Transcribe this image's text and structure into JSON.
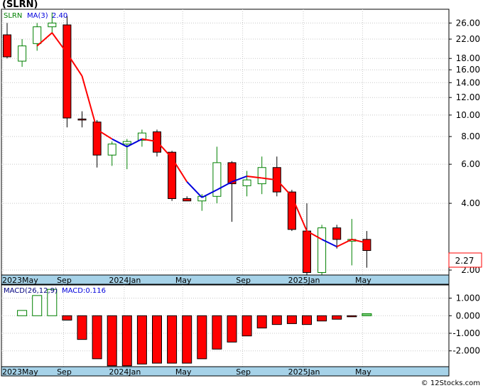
{
  "title": "(SLRN)",
  "watermark": "© 12Stocks.com",
  "colors": {
    "up_candle": "#008000",
    "down_candle": "#ff0000",
    "ma_down": "#ff0000",
    "ma_up": "#0000dd",
    "macd_text": "#000080",
    "axis_band": "#a6d2e8",
    "last_price_box": "#ff0000"
  },
  "chart_data": [
    {
      "type": "candlestick",
      "legend": {
        "ticker": "SLRN",
        "ma_label": "MA(3)",
        "ma_value": "2.40"
      },
      "y_scale": "log",
      "ylim": [
        1.9,
        30
      ],
      "y_ticks": [
        "26.00",
        "22.00",
        "18.00",
        "16.00",
        "14.00",
        "12.00",
        "10.00",
        "8.00",
        "6.00",
        "4.00",
        "2.00"
      ],
      "x_ticks": [
        "2023May",
        "Sep",
        "2024Jan",
        "May",
        "Sep",
        "2025Jan",
        "May"
      ],
      "last_price": "2.27",
      "candles": [
        {
          "o": 23.0,
          "h": 26.0,
          "l": 18.0,
          "c": 18.3
        },
        {
          "o": 17.5,
          "h": 22.0,
          "l": 16.5,
          "c": 20.5
        },
        {
          "o": 21.0,
          "h": 26.0,
          "l": 19.5,
          "c": 25.0
        },
        {
          "o": 25.0,
          "h": 29.0,
          "l": 23.5,
          "c": 26.0
        },
        {
          "o": 25.5,
          "h": 28.0,
          "l": 8.8,
          "c": 9.7
        },
        {
          "o": 9.6,
          "h": 10.4,
          "l": 8.8,
          "c": 9.5
        },
        {
          "o": 9.3,
          "h": 9.5,
          "l": 5.8,
          "c": 6.6
        },
        {
          "o": 6.6,
          "h": 7.6,
          "l": 5.9,
          "c": 7.4
        },
        {
          "o": 7.4,
          "h": 7.8,
          "l": 5.7,
          "c": 7.6
        },
        {
          "o": 7.7,
          "h": 8.6,
          "l": 7.2,
          "c": 8.3
        },
        {
          "o": 8.4,
          "h": 8.6,
          "l": 6.5,
          "c": 6.8
        },
        {
          "o": 6.8,
          "h": 6.9,
          "l": 4.1,
          "c": 4.2
        },
        {
          "o": 4.2,
          "h": 4.3,
          "l": 4.1,
          "c": 4.1
        },
        {
          "o": 4.1,
          "h": 4.4,
          "l": 3.7,
          "c": 4.3
        },
        {
          "o": 4.3,
          "h": 7.2,
          "l": 4.0,
          "c": 6.1
        },
        {
          "o": 6.1,
          "h": 6.2,
          "l": 3.3,
          "c": 4.9
        },
        {
          "o": 4.8,
          "h": 5.6,
          "l": 4.3,
          "c": 5.1
        },
        {
          "o": 4.9,
          "h": 6.5,
          "l": 4.4,
          "c": 5.8
        },
        {
          "o": 5.8,
          "h": 6.5,
          "l": 4.3,
          "c": 4.5
        },
        {
          "o": 4.5,
          "h": 4.6,
          "l": 3.0,
          "c": 3.05
        },
        {
          "o": 3.0,
          "h": 4.0,
          "l": 1.9,
          "c": 1.95
        },
        {
          "o": 1.95,
          "h": 3.2,
          "l": 1.9,
          "c": 3.1
        },
        {
          "o": 3.1,
          "h": 3.2,
          "l": 2.5,
          "c": 2.75
        },
        {
          "o": 2.7,
          "h": 3.4,
          "l": 2.1,
          "c": 2.75
        },
        {
          "o": 2.75,
          "h": 3.0,
          "l": 2.05,
          "c": 2.45
        }
      ],
      "ma3": [
        {
          "i": 2,
          "v": 20.5,
          "dir": "up"
        },
        {
          "i": 3,
          "v": 23.5,
          "dir": "down"
        },
        {
          "i": 4,
          "v": 19.0,
          "dir": "down"
        },
        {
          "i": 5,
          "v": 15.0,
          "dir": "down"
        },
        {
          "i": 6,
          "v": 8.6,
          "dir": "down"
        },
        {
          "i": 7,
          "v": 7.8,
          "dir": "down"
        },
        {
          "i": 8,
          "v": 7.2,
          "dir": "up"
        },
        {
          "i": 9,
          "v": 7.8,
          "dir": "up"
        },
        {
          "i": 10,
          "v": 7.6,
          "dir": "down"
        },
        {
          "i": 11,
          "v": 6.4,
          "dir": "down"
        },
        {
          "i": 12,
          "v": 5.0,
          "dir": "down"
        },
        {
          "i": 13,
          "v": 4.25,
          "dir": "up"
        },
        {
          "i": 14,
          "v": 4.6,
          "dir": "up"
        },
        {
          "i": 15,
          "v": 5.0,
          "dir": "up"
        },
        {
          "i": 16,
          "v": 5.3,
          "dir": "up"
        },
        {
          "i": 17,
          "v": 5.2,
          "dir": "down"
        },
        {
          "i": 18,
          "v": 5.1,
          "dir": "down"
        },
        {
          "i": 19,
          "v": 4.3,
          "dir": "down"
        },
        {
          "i": 20,
          "v": 3.0,
          "dir": "down"
        },
        {
          "i": 21,
          "v": 2.75,
          "dir": "down"
        },
        {
          "i": 22,
          "v": 2.55,
          "dir": "up"
        },
        {
          "i": 23,
          "v": 2.75,
          "dir": "down"
        },
        {
          "i": 24,
          "v": 2.65,
          "dir": "down"
        }
      ]
    },
    {
      "type": "bar",
      "legend": {
        "label": "MACD(26,12,9)",
        "value_label": "MACD:0.116"
      },
      "ylim": [
        -2.9,
        1.75
      ],
      "y_ticks": [
        {
          "label": "1.000",
          "v": 1.0
        },
        {
          "label": "0.000",
          "v": 0.0
        },
        {
          "label": "-1.000",
          "v": -1.0
        },
        {
          "label": "-2.000",
          "v": -2.0
        }
      ],
      "x_ticks": [
        "2023May",
        "Sep",
        "2024Jan",
        "May",
        "Sep",
        "2025Jan",
        "May"
      ],
      "values": [
        null,
        0.3,
        1.15,
        1.5,
        -0.25,
        -1.35,
        -2.45,
        -2.85,
        -2.85,
        -2.75,
        -2.7,
        -2.7,
        -2.7,
        -2.45,
        -1.9,
        -1.5,
        -1.15,
        -0.7,
        -0.5,
        -0.45,
        -0.5,
        -0.3,
        -0.2,
        -0.05,
        0.116
      ]
    }
  ]
}
